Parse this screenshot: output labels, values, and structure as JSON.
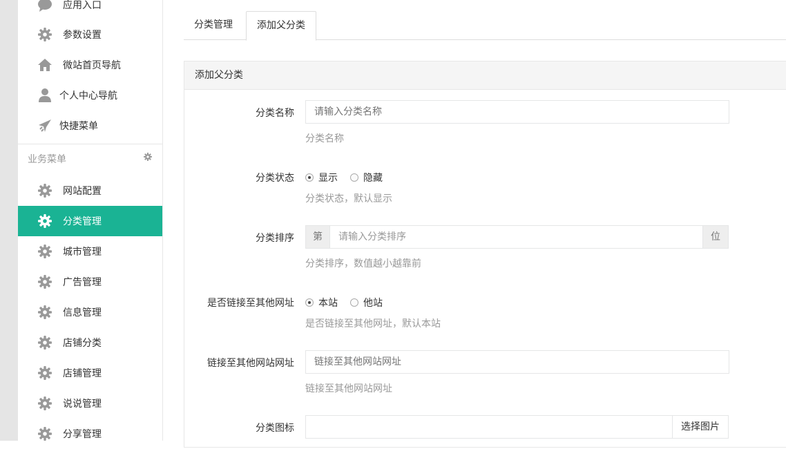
{
  "sidebar": {
    "items_top": [
      {
        "label": "应用入口",
        "icon": "comment-icon"
      },
      {
        "label": "参数设置",
        "icon": "gear-icon"
      },
      {
        "label": "微站首页导航",
        "icon": "home-icon"
      },
      {
        "label": "个人中心导航",
        "icon": "user-icon"
      },
      {
        "label": "快捷菜单",
        "icon": "plane-icon"
      }
    ],
    "group_label": "业务菜单",
    "items_biz": [
      {
        "label": "网站配置",
        "icon": "gear-icon"
      },
      {
        "label": "分类管理",
        "icon": "gear-icon",
        "active": true
      },
      {
        "label": "城市管理",
        "icon": "gear-icon"
      },
      {
        "label": "广告管理",
        "icon": "gear-icon"
      },
      {
        "label": "信息管理",
        "icon": "gear-icon"
      },
      {
        "label": "店铺分类",
        "icon": "gear-icon"
      },
      {
        "label": "店铺管理",
        "icon": "gear-icon"
      },
      {
        "label": "说说管理",
        "icon": "gear-icon"
      },
      {
        "label": "分享管理",
        "icon": "gear-icon"
      }
    ]
  },
  "tabs": [
    {
      "label": "分类管理",
      "active": false
    },
    {
      "label": "添加父分类",
      "active": true
    }
  ],
  "panel": {
    "title": "添加父分类",
    "fields": {
      "name": {
        "label": "分类名称",
        "placeholder": "请输入分类名称",
        "help": "分类名称"
      },
      "status": {
        "label": "分类状态",
        "options": [
          "显示",
          "隐藏"
        ],
        "selected": "显示",
        "help": "分类状态，默认显示"
      },
      "order": {
        "label": "分类排序",
        "prefix": "第",
        "placeholder": "请输入分类排序",
        "suffix": "位",
        "help": "分类排序，数值越小越靠前"
      },
      "link": {
        "label": "是否链接至其他网址",
        "options": [
          "本站",
          "他站"
        ],
        "selected": "本站",
        "help": "是否链接至其他网址，默认本站"
      },
      "url": {
        "label": "链接至其他网站网址",
        "placeholder": "链接至其他网站网址",
        "help": "链接至其他网站网址"
      },
      "icon": {
        "label": "分类图标",
        "button": "选择图片"
      }
    }
  },
  "colors": {
    "accent": "#1ab394",
    "icon_gray": "#999999"
  }
}
